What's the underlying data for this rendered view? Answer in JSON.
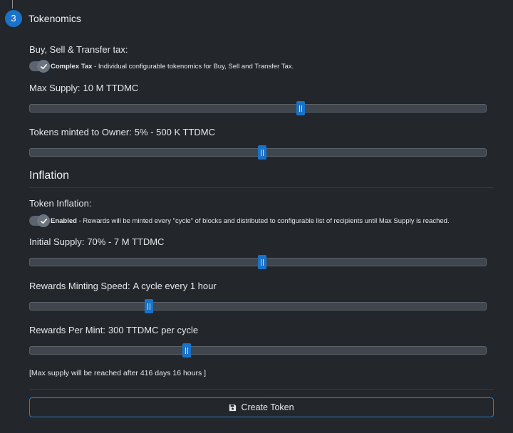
{
  "step": {
    "number": "3",
    "title": "Tokenomics"
  },
  "tax": {
    "label": "Buy, Sell & Transfer tax:",
    "toggle_on": true,
    "toggle_title": "Complex Tax",
    "toggle_desc": " - Individual configurable tokenomics for Buy, Sell and Transfer Tax."
  },
  "sliders": {
    "max_supply": {
      "label": "Max Supply:",
      "value": "10 M TTDMC",
      "position": 0.593
    },
    "owner_tokens": {
      "label": "Tokens minted to Owner:",
      "value": "5% - 500 K TTDMC",
      "position": 0.509
    },
    "initial_supply": {
      "label": "Initial Supply:",
      "value": "70% - 7 M TTDMC",
      "position": 0.509
    },
    "minting_speed": {
      "label": "Rewards Minting Speed:",
      "value": "A cycle every 1 hour",
      "position": 0.261
    },
    "per_mint": {
      "label": "Rewards Per Mint:",
      "value": "300 TTDMC per cycle",
      "position": 0.343
    }
  },
  "inflation": {
    "heading": "Inflation",
    "label": "Token Inflation:",
    "toggle_on": true,
    "toggle_title": "Enabled",
    "toggle_desc": " - Rewards will be minted every \"cycle\" of blocks and distributed to configurable list of recipients until Max Supply is reached."
  },
  "note": "[Max supply will be reached after 416 days 16 hours ]",
  "create_button": {
    "label": "Create Token",
    "icon": "save-icon"
  },
  "colors": {
    "accent": "#1a73c8",
    "background": "#23272b",
    "track": "#40464d"
  }
}
